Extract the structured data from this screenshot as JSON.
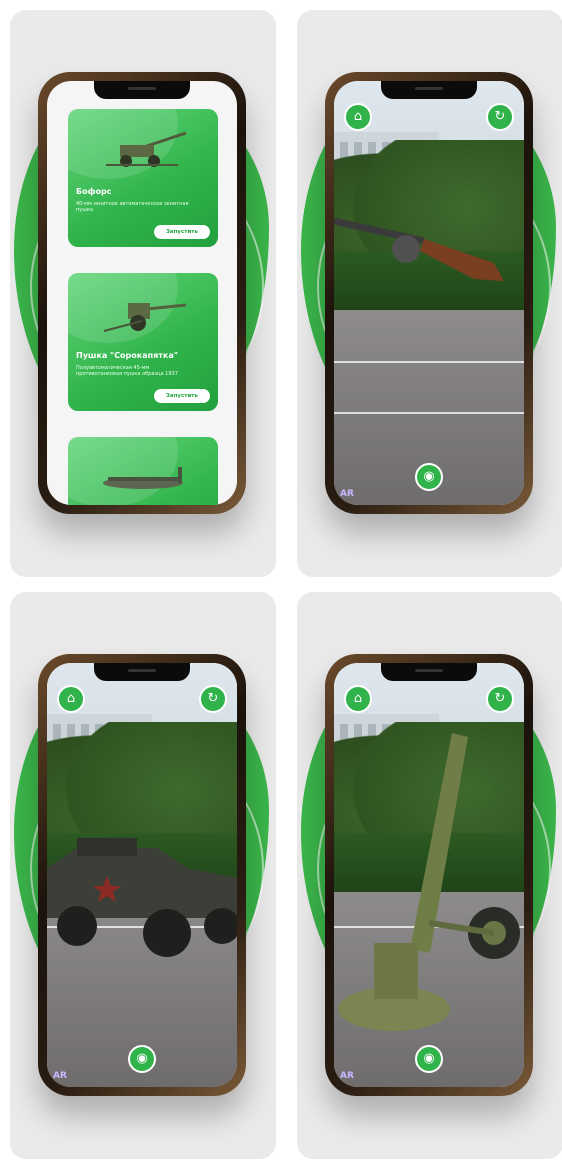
{
  "list_screen": {
    "cards": [
      {
        "title": "Бофорс",
        "desc": "40-мм зенитное автоматическое зенитная пушка",
        "button": "Запустить"
      },
      {
        "title": "Пушка \"Сорокапятка\"",
        "desc": "Полуавтоматическая 45-мм противотанковая пушка образца 1937",
        "button": "Запустить"
      },
      {
        "title": "",
        "desc": "",
        "button": ""
      }
    ]
  },
  "ar_screens": {
    "home_icon": "home-icon",
    "reload_icon": "reload-icon",
    "camera_icon": "camera-icon",
    "logo": "AR"
  },
  "colors": {
    "accent": "#3bb54a",
    "card_dark": "#22a03f"
  }
}
